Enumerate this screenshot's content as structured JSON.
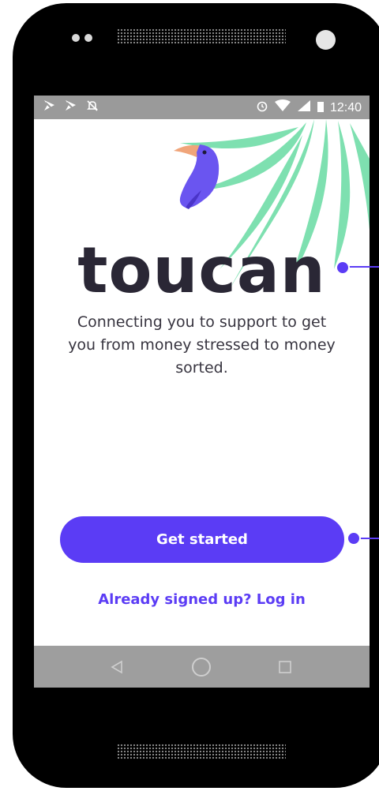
{
  "status_bar": {
    "left_icons": [
      "notification-icon",
      "notification-icon",
      "alarm-off-icon"
    ],
    "right_icons": [
      "alarm-icon",
      "wifi-icon",
      "signal-icon",
      "battery-icon"
    ],
    "time": "12:40"
  },
  "brand": {
    "logo_icon": "toucan-bird-icon",
    "name": "toucan"
  },
  "tagline": "Connecting you to support to get you from money stressed to money sorted.",
  "actions": {
    "primary_label": "Get started",
    "secondary_label": "Already signed up? Log in"
  },
  "nav": {
    "back_icon": "back-triangle-icon",
    "home_icon": "home-circle-icon",
    "recents_icon": "recents-square-icon"
  },
  "colors": {
    "accent": "#5b3cf5",
    "wordmark": "#2a2735",
    "leaf": "#7ee0b0",
    "beak": "#f0a57a"
  }
}
